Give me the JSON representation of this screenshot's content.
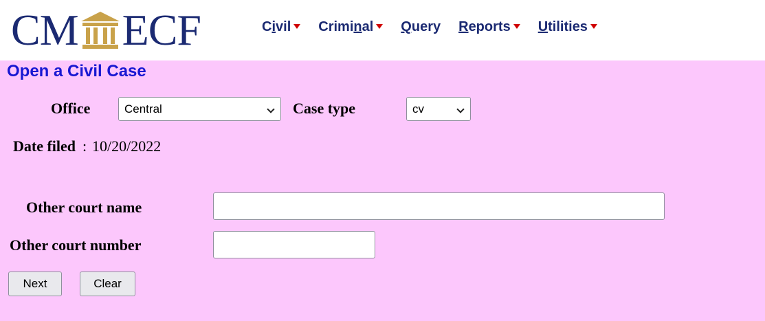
{
  "logo": {
    "left_text": "CM",
    "right_text": "ECF",
    "icon": "courthouse-icon"
  },
  "menu": [
    {
      "label": "Civil",
      "has_dropdown": true
    },
    {
      "label": "Criminal",
      "has_dropdown": true
    },
    {
      "label": "Query",
      "has_dropdown": false
    },
    {
      "label": "Reports",
      "has_dropdown": true
    },
    {
      "label": "Utilities",
      "has_dropdown": true
    }
  ],
  "page": {
    "title": "Open a Civil Case",
    "office_label": "Office",
    "office_value": "Central",
    "case_type_label": "Case type",
    "case_type_value": "cv",
    "date_filed_label": "Date filed",
    "date_filed_value": "10/20/2022",
    "other_court_name_label": "Other court name",
    "other_court_name_value": "",
    "other_court_number_label": "Other court number",
    "other_court_number_value": "",
    "next_button": "Next",
    "clear_button": "Clear"
  },
  "colors": {
    "content_background": "#fcc7fc",
    "title": "#1818d2",
    "menu_text": "#1b2a72",
    "caret": "#d00000",
    "logo_gold": "#c9a24a"
  }
}
